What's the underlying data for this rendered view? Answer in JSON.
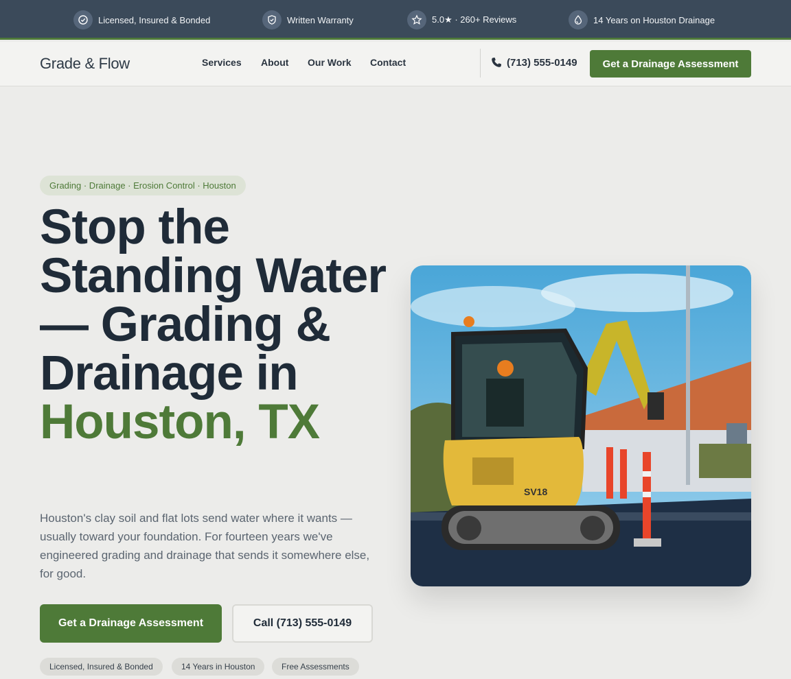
{
  "topbar": {
    "items": [
      {
        "label": "Licensed, Insured & Bonded",
        "icon": "badge-check-icon"
      },
      {
        "label": "Written Warranty",
        "icon": "shield-check-icon"
      },
      {
        "label": "5.0★ · 260+ Reviews",
        "icon": "star-icon"
      },
      {
        "label": "14 Years on Houston Drainage",
        "icon": "water-drop-icon"
      }
    ]
  },
  "nav": {
    "logo": "Grade & Flow",
    "links": [
      "Services",
      "About",
      "Our Work",
      "Contact"
    ],
    "phone": "(713) 555-0149",
    "cta": "Get a Drainage Assessment"
  },
  "hero": {
    "tag": "Grading · Drainage · Erosion Control · Houston",
    "headline": "Stop the Standing Water — Grading & Drainage in",
    "headline_accent": "Houston, TX",
    "lede": "Houston's clay soil and flat lots send water where it wants — usually toward your foundation. For fourteen years we've engineered grading and drainage that sends it somewhere else, for good.",
    "primary_cta": "Get a Drainage Assessment",
    "secondary_cta": "Call (713) 555-0149",
    "chips": [
      "Licensed, Insured & Bonded",
      "14 Years in Houston",
      "Free Assessments"
    ]
  },
  "colors": {
    "brand_green": "#4e7a38",
    "topbar_bg": "#3b4a5a",
    "text_dark": "#1f2b38"
  }
}
